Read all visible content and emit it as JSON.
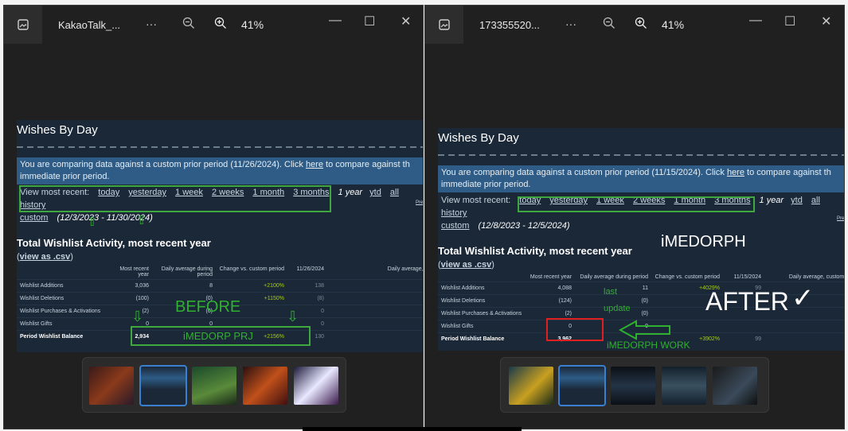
{
  "left": {
    "filename": "KakaoTalk_...",
    "zoom": "41%",
    "title": "Wishes By Day",
    "banner_a": "You are comparing data against a custom prior period (11/26/2024). Click ",
    "banner_link": "here",
    "banner_b": " to compare against th",
    "banner_c": "immediate prior period.",
    "view_label": "View most recent:",
    "ranges": [
      "today",
      "yesterday",
      "1 week",
      "2 weeks",
      "1 month",
      "3 months"
    ],
    "one_year": "1 year",
    "ytd": "ytd",
    "all_history": "all history",
    "custom": "custom",
    "custom_range": "(12/3/2023 - 11/30/2024)",
    "pref": "Pref",
    "section_title": "Total Wishlist Activity, most recent year",
    "csv_open": "(",
    "csv_link": "view as .csv",
    "csv_close": ")",
    "headers": [
      "Most recent year",
      "Daily average during period",
      "Change vs. custom period",
      "11/26/2024",
      "Daily average, c"
    ],
    "rows": [
      {
        "label": "Wishlist Additions",
        "v1": "3,036",
        "v2": "8",
        "v3": "+2100%",
        "v4": "138"
      },
      {
        "label": "Wishlist Deletions",
        "v1": "(100)",
        "v2": "(0)",
        "v3": "+1150%",
        "v4": "(8)"
      },
      {
        "label": "Wishlist Purchases & Activations",
        "v1": "(2)",
        "v2": "(0)",
        "v3": "",
        "v4": "0"
      },
      {
        "label": "Wishlist Gifts",
        "v1": "0",
        "v2": "0",
        "v3": "",
        "v4": "0"
      },
      {
        "label": "Period Wishlist Balance",
        "v1": "2,934",
        "v2": "",
        "v3": "+2156%",
        "v4": "130"
      }
    ],
    "anno_before": "BEFORE",
    "anno_prj": "iMEDORP PRJ"
  },
  "right": {
    "filename": "173355520...",
    "zoom": "41%",
    "title": "Wishes By Day",
    "banner_a": "You are comparing data against a custom prior period (11/15/2024). Click ",
    "banner_link": "here",
    "banner_b": " to compare against th",
    "banner_c": "immediate prior period.",
    "view_label": "View most recent:",
    "ranges": [
      "today",
      "yesterday",
      "1 week",
      "2 weeks",
      "1 month",
      "3 months"
    ],
    "one_year": "1 year",
    "ytd": "ytd",
    "all_history": "all history",
    "custom": "custom",
    "custom_range": "(12/8/2023 - 12/5/2024)",
    "pref": "Pref",
    "section_title": "Total Wishlist Activity, most recent year",
    "csv_open": "(",
    "csv_link": "view as .csv",
    "csv_close": ")",
    "headers": [
      "Most recent year",
      "Daily average during period",
      "Change vs. custom period",
      "11/15/2024",
      "Daily average, custom p"
    ],
    "rows": [
      {
        "label": "Wishlist Additions",
        "v1": "4,088",
        "v2": "11",
        "v3": "+4029%",
        "v4": "99"
      },
      {
        "label": "Wishlist Deletions",
        "v1": "(124)",
        "v2": "(0)",
        "v3": "",
        "v4": ""
      },
      {
        "label": "Wishlist Purchases & Activations",
        "v1": "(2)",
        "v2": "(0)",
        "v3": "",
        "v4": ""
      },
      {
        "label": "Wishlist Gifts",
        "v1": "0",
        "v2": "0",
        "v3": "",
        "v4": ""
      },
      {
        "label": "Period Wishlist Balance",
        "v1": "3,962",
        "v2": "",
        "v3": "+3902%",
        "v4": "99"
      }
    ],
    "anno_brand": "iMEDORPH",
    "anno_last": "last",
    "anno_update": "update",
    "anno_after": "AFTER",
    "anno_check": "✓",
    "anno_work": "iMEDORPH WORK"
  },
  "icons": {
    "more": "···",
    "minimize": "—",
    "maximize": "☐",
    "close": "✕"
  },
  "colors": {
    "annotation_green": "#2fb12f",
    "highlight_red": "#e02020",
    "selected_thumb": "#3a7fd0",
    "steam_bg": "#1b2838"
  }
}
